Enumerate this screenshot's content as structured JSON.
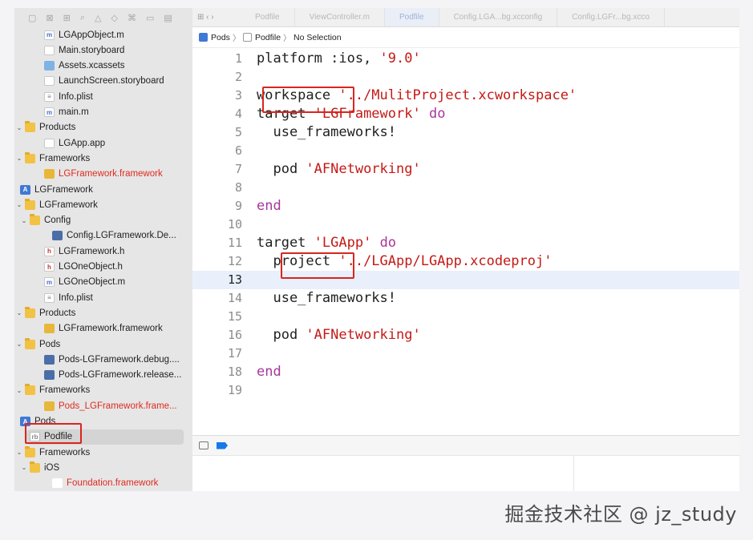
{
  "tabs": [
    "Podfile",
    "ViewController.m",
    "Podfile",
    "Config.LGA...bg.xcconfig",
    "Config.LGFr...bg.xcco"
  ],
  "breadcrumb": {
    "root": "Pods",
    "file": "Podfile",
    "selection": "No Selection"
  },
  "navigator": [
    {
      "label": "LGAppObject.m",
      "icon": "m-file-icon",
      "chev": "",
      "red": false
    },
    {
      "label": "Main.storyboard",
      "icon": "storyboard-icon",
      "chev": "",
      "red": false
    },
    {
      "label": "Assets.xcassets",
      "icon": "assets-icon",
      "chev": "",
      "red": false
    },
    {
      "label": "LaunchScreen.storyboard",
      "icon": "storyboard-icon",
      "chev": "",
      "red": false
    },
    {
      "label": "Info.plist",
      "icon": "plist-icon",
      "chev": "",
      "red": false
    },
    {
      "label": "main.m",
      "icon": "m-file-icon",
      "chev": "",
      "red": false
    },
    {
      "label": "Products",
      "icon": "folder-icon",
      "chev": "v",
      "red": false
    },
    {
      "label": "LGApp.app",
      "icon": "app-icon",
      "chev": "",
      "red": false
    },
    {
      "label": "Frameworks",
      "icon": "folder-icon",
      "chev": "v",
      "red": false
    },
    {
      "label": "LGFramework.framework",
      "icon": "framework-icon",
      "chev": "",
      "red": true
    },
    {
      "label": "LGFramework",
      "icon": "project-icon",
      "chev": "",
      "red": false
    },
    {
      "label": "LGFramework",
      "icon": "folder-icon",
      "chev": "v",
      "red": false
    },
    {
      "label": "Config",
      "icon": "folder-icon",
      "chev": "v",
      "red": false
    },
    {
      "label": "Config.LGFramework.De...",
      "icon": "config-icon",
      "chev": "",
      "red": false
    },
    {
      "label": "LGFramework.h",
      "icon": "h-file-icon",
      "chev": "",
      "red": false
    },
    {
      "label": "LGOneObject.h",
      "icon": "h-file-icon",
      "chev": "",
      "red": false
    },
    {
      "label": "LGOneObject.m",
      "icon": "m-file-icon",
      "chev": "",
      "red": false
    },
    {
      "label": "Info.plist",
      "icon": "plist-icon",
      "chev": "",
      "red": false
    },
    {
      "label": "Products",
      "icon": "folder-icon",
      "chev": "v",
      "red": false
    },
    {
      "label": "LGFramework.framework",
      "icon": "framework-icon",
      "chev": "",
      "red": false
    },
    {
      "label": "Pods",
      "icon": "folder-icon",
      "chev": "v",
      "red": false
    },
    {
      "label": "Pods-LGFramework.debug....",
      "icon": "config-icon",
      "chev": "",
      "red": false
    },
    {
      "label": "Pods-LGFramework.release...",
      "icon": "config-icon",
      "chev": "",
      "red": false
    },
    {
      "label": "Frameworks",
      "icon": "folder-icon",
      "chev": "v",
      "red": false
    },
    {
      "label": "Pods_LGFramework.frame...",
      "icon": "framework-icon",
      "chev": "",
      "red": true
    },
    {
      "label": "Pods",
      "icon": "project-icon",
      "chev": "",
      "red": false
    },
    {
      "label": "Podfile",
      "icon": "ruby-file-icon",
      "chev": "",
      "red": false,
      "selected": true
    },
    {
      "label": "Frameworks",
      "icon": "folder-icon",
      "chev": "v",
      "red": false
    },
    {
      "label": "iOS",
      "icon": "folder-icon",
      "chev": "v",
      "red": false
    },
    {
      "label": "Foundation.framework",
      "icon": "shield-icon",
      "chev": "",
      "red": true
    }
  ],
  "code_lines": [
    {
      "n": "1",
      "parts": [
        [
          "p",
          "platform :ios, "
        ],
        [
          "s",
          "'9.0'"
        ]
      ]
    },
    {
      "n": "2",
      "parts": []
    },
    {
      "n": "3",
      "parts": [
        [
          "p",
          "workspace "
        ],
        [
          "s",
          "'../MulitProject.xcworkspace'"
        ]
      ]
    },
    {
      "n": "4",
      "parts": [
        [
          "p",
          "target "
        ],
        [
          "s",
          "'LGFramework'"
        ],
        [
          "p",
          " "
        ],
        [
          "k",
          "do"
        ]
      ]
    },
    {
      "n": "5",
      "parts": [
        [
          "p",
          "  use_frameworks!"
        ]
      ]
    },
    {
      "n": "6",
      "parts": []
    },
    {
      "n": "7",
      "parts": [
        [
          "p",
          "  pod "
        ],
        [
          "s",
          "'AFNetworking'"
        ]
      ]
    },
    {
      "n": "8",
      "parts": []
    },
    {
      "n": "9",
      "parts": [
        [
          "k",
          "end"
        ]
      ]
    },
    {
      "n": "10",
      "parts": []
    },
    {
      "n": "11",
      "parts": [
        [
          "p",
          "target "
        ],
        [
          "s",
          "'LGApp'"
        ],
        [
          "p",
          " "
        ],
        [
          "k",
          "do"
        ]
      ]
    },
    {
      "n": "12",
      "parts": [
        [
          "p",
          "  project "
        ],
        [
          "s",
          "'../LGApp/LGApp.xcodeproj'"
        ]
      ]
    },
    {
      "n": "13",
      "parts": [],
      "current": true
    },
    {
      "n": "14",
      "parts": [
        [
          "p",
          "  use_frameworks!"
        ]
      ]
    },
    {
      "n": "15",
      "parts": []
    },
    {
      "n": "16",
      "parts": [
        [
          "p",
          "  pod "
        ],
        [
          "s",
          "'AFNetworking'"
        ]
      ]
    },
    {
      "n": "17",
      "parts": []
    },
    {
      "n": "18",
      "parts": [
        [
          "k",
          "end"
        ]
      ]
    },
    {
      "n": "19",
      "parts": []
    }
  ],
  "watermark": "掘金技术社区 @ jz_study",
  "colors": {
    "keyword": "#a9369a",
    "string": "#c41a16",
    "highlight": "#d9251d",
    "current_line": "#e9f0fb"
  }
}
